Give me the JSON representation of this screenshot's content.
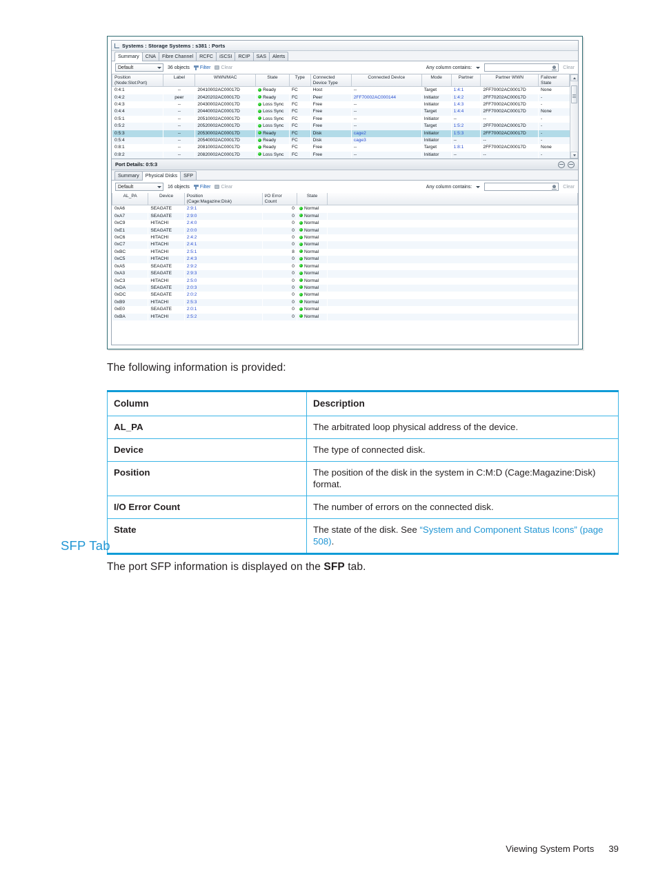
{
  "figure": {
    "window_title": "Systems : Storage Systems : s381 : Ports",
    "title_icon": "systems-icon",
    "top_tabs": [
      {
        "label": "Summary",
        "active": true
      },
      {
        "label": "CNA",
        "active": false
      },
      {
        "label": "Fibre Channel",
        "active": false
      },
      {
        "label": "RCFC",
        "active": false
      },
      {
        "label": "iSCSI",
        "active": false
      },
      {
        "label": "RCIP",
        "active": false
      },
      {
        "label": "SAS",
        "active": false
      },
      {
        "label": "Alerts",
        "active": false
      }
    ],
    "top_toolbar": {
      "view_select": "Default",
      "object_count": "36 objects",
      "filter_label": "Filter",
      "clear_label": "Clear",
      "any_column_label": "Any column contains:",
      "search_value": "",
      "search_clear_label": "Clear"
    },
    "ports_grid": {
      "columns": [
        "Position\n(Node:Slot:Port)",
        "Label",
        "WWN/MAC",
        "State",
        "Type",
        "Connected\nDevice Type",
        "Connected Device",
        "Mode",
        "Partner",
        "Partner WWN",
        "Failover\nState"
      ],
      "rows": [
        {
          "position": "0:4:1",
          "label": "--",
          "wwn": "20410002AC00017D",
          "state": "Ready",
          "type": "FC",
          "cdt": "Host",
          "cd": "--",
          "mode": "Target",
          "partner": "1:4:1",
          "pwwn": "2FF70002AC00017D",
          "failover": "None",
          "selected": false
        },
        {
          "position": "0:4:2",
          "label": "peer",
          "wwn": "20420202AC00017D",
          "state": "Ready",
          "type": "FC",
          "cdt": "Peer",
          "cd": "2FF70002AC000144",
          "mode": "Initiator",
          "partner": "1:4:2",
          "pwwn": "2FF70202AC00017D",
          "failover": "-",
          "selected": false
        },
        {
          "position": "0:4:3",
          "label": "--",
          "wwn": "20430002AC00017D",
          "state": "Loss Sync",
          "type": "FC",
          "cdt": "Free",
          "cd": "--",
          "mode": "Initiator",
          "partner": "1:4:3",
          "pwwn": "2FF70002AC00017D",
          "failover": "-",
          "selected": false
        },
        {
          "position": "0:4:4",
          "label": "--",
          "wwn": "20440002AC00017D",
          "state": "Loss Sync",
          "type": "FC",
          "cdt": "Free",
          "cd": "--",
          "mode": "Target",
          "partner": "1:4:4",
          "pwwn": "2FF70002AC00017D",
          "failover": "None",
          "selected": false
        },
        {
          "position": "0:5:1",
          "label": "--",
          "wwn": "20510002AC00017D",
          "state": "Loss Sync",
          "type": "FC",
          "cdt": "Free",
          "cd": "--",
          "mode": "Initiator",
          "partner": "--",
          "pwwn": "--",
          "failover": "-",
          "selected": false
        },
        {
          "position": "0:5:2",
          "label": "--",
          "wwn": "20520002AC00017D",
          "state": "Loss Sync",
          "type": "FC",
          "cdt": "Free",
          "cd": "--",
          "mode": "Target",
          "partner": "1:5:2",
          "pwwn": "2FF70002AC00017D",
          "failover": "-",
          "selected": false
        },
        {
          "position": "0:5:3",
          "label": "--",
          "wwn": "20530002AC00017D",
          "state": "Ready",
          "type": "FC",
          "cdt": "Disk",
          "cd": "cage2",
          "mode": "Initiator",
          "partner": "1:5:3",
          "pwwn": "2FF70002AC00017D",
          "failover": "-",
          "selected": true
        },
        {
          "position": "0:5:4",
          "label": "--",
          "wwn": "20540002AC00017D",
          "state": "Ready",
          "type": "FC",
          "cdt": "Disk",
          "cd": "cage3",
          "mode": "Initiator",
          "partner": "--",
          "pwwn": "--",
          "failover": "-",
          "selected": false
        },
        {
          "position": "0:8:1",
          "label": "--",
          "wwn": "20810002AC00017D",
          "state": "Ready",
          "type": "FC",
          "cdt": "Free",
          "cd": "--",
          "mode": "Target",
          "partner": "1:8:1",
          "pwwn": "2FF70002AC00017D",
          "failover": "None",
          "selected": false
        },
        {
          "position": "0:8:2",
          "label": "--",
          "wwn": "20820002AC00017D",
          "state": "Loss Sync",
          "type": "FC",
          "cdt": "Free",
          "cd": "--",
          "mode": "Initiator",
          "partner": "--",
          "pwwn": "--",
          "failover": "-",
          "selected": false
        }
      ]
    },
    "details": {
      "header": "Port Details: 0:5:3",
      "header_icons": [
        "refresh-icon",
        "help-icon"
      ],
      "tabs": [
        {
          "label": "Summary",
          "active": false
        },
        {
          "label": "Physical Disks",
          "active": true
        },
        {
          "label": "SFP",
          "active": false
        }
      ],
      "toolbar": {
        "view_select": "Default",
        "object_count": "16 objects",
        "filter_label": "Filter",
        "clear_label": "Clear",
        "any_column_label": "Any column contains:",
        "search_value": "",
        "search_clear_label": "Clear"
      },
      "disks_grid": {
        "columns": [
          "AL_PA",
          "Device",
          "Position\n(Cage:Magazine:Disk)",
          "I/O Error\nCount",
          "State",
          ""
        ],
        "rows": [
          {
            "al_pa": "0xA6",
            "device": "SEAGATE",
            "position": "2:9:1",
            "errors": "0",
            "state": "Normal"
          },
          {
            "al_pa": "0xA7",
            "device": "SEAGATE",
            "position": "2:9:0",
            "errors": "0",
            "state": "Normal"
          },
          {
            "al_pa": "0xC9",
            "device": "HITACHI",
            "position": "2:4:0",
            "errors": "0",
            "state": "Normal"
          },
          {
            "al_pa": "0xE1",
            "device": "SEAGATE",
            "position": "2:0:0",
            "errors": "0",
            "state": "Normal"
          },
          {
            "al_pa": "0xC6",
            "device": "HITACHI",
            "position": "2:4:2",
            "errors": "0",
            "state": "Normal"
          },
          {
            "al_pa": "0xC7",
            "device": "HITACHI",
            "position": "2:4:1",
            "errors": "0",
            "state": "Normal"
          },
          {
            "al_pa": "0xBC",
            "device": "HITACHI",
            "position": "2:5:1",
            "errors": "8",
            "state": "Normal"
          },
          {
            "al_pa": "0xC5",
            "device": "HITACHI",
            "position": "2:4:3",
            "errors": "0",
            "state": "Normal"
          },
          {
            "al_pa": "0xA5",
            "device": "SEAGATE",
            "position": "2:9:2",
            "errors": "0",
            "state": "Normal"
          },
          {
            "al_pa": "0xA3",
            "device": "SEAGATE",
            "position": "2:9:3",
            "errors": "0",
            "state": "Normal"
          },
          {
            "al_pa": "0xC3",
            "device": "HITACHI",
            "position": "2:5:0",
            "errors": "0",
            "state": "Normal"
          },
          {
            "al_pa": "0xDA",
            "device": "SEAGATE",
            "position": "2:0:3",
            "errors": "0",
            "state": "Normal"
          },
          {
            "al_pa": "0xDC",
            "device": "SEAGATE",
            "position": "2:0:2",
            "errors": "0",
            "state": "Normal"
          },
          {
            "al_pa": "0xB9",
            "device": "HITACHI",
            "position": "2:5:3",
            "errors": "0",
            "state": "Normal"
          },
          {
            "al_pa": "0xE0",
            "device": "SEAGATE",
            "position": "2:0:1",
            "errors": "0",
            "state": "Normal"
          },
          {
            "al_pa": "0xBA",
            "device": "HITACHI",
            "position": "2:5:2",
            "errors": "0",
            "state": "Normal"
          }
        ]
      }
    }
  },
  "document": {
    "intro": "The following information is provided:",
    "table": {
      "head": {
        "column": "Column",
        "description": "Description"
      },
      "rows": [
        {
          "column": "AL_PA",
          "description": "The arbitrated loop physical address of the device."
        },
        {
          "column": "Device",
          "description": "The type of connected disk."
        },
        {
          "column": "Position",
          "description": "The position of the disk in the system in C:M:D (Cage:Magazine:Disk) format."
        },
        {
          "column": "I/O Error Count",
          "description": "The number of errors on the connected disk."
        },
        {
          "column": "State",
          "description_prefix": "The state of the disk. See ",
          "description_link": "“System and Component Status Icons” (page 508)",
          "description_suffix": "."
        }
      ]
    },
    "sfp_heading": "SFP Tab",
    "sfp_para_prefix": "The port SFP information is displayed on the ",
    "sfp_para_bold": "SFP",
    "sfp_para_suffix": " tab.",
    "footer_title": "Viewing System Ports",
    "footer_page": "39"
  },
  "colors": {
    "accent_blue": "#2196d4",
    "table_border": "#39b4e6",
    "selection": "#b2dbe8",
    "status_green": "#19c219"
  }
}
